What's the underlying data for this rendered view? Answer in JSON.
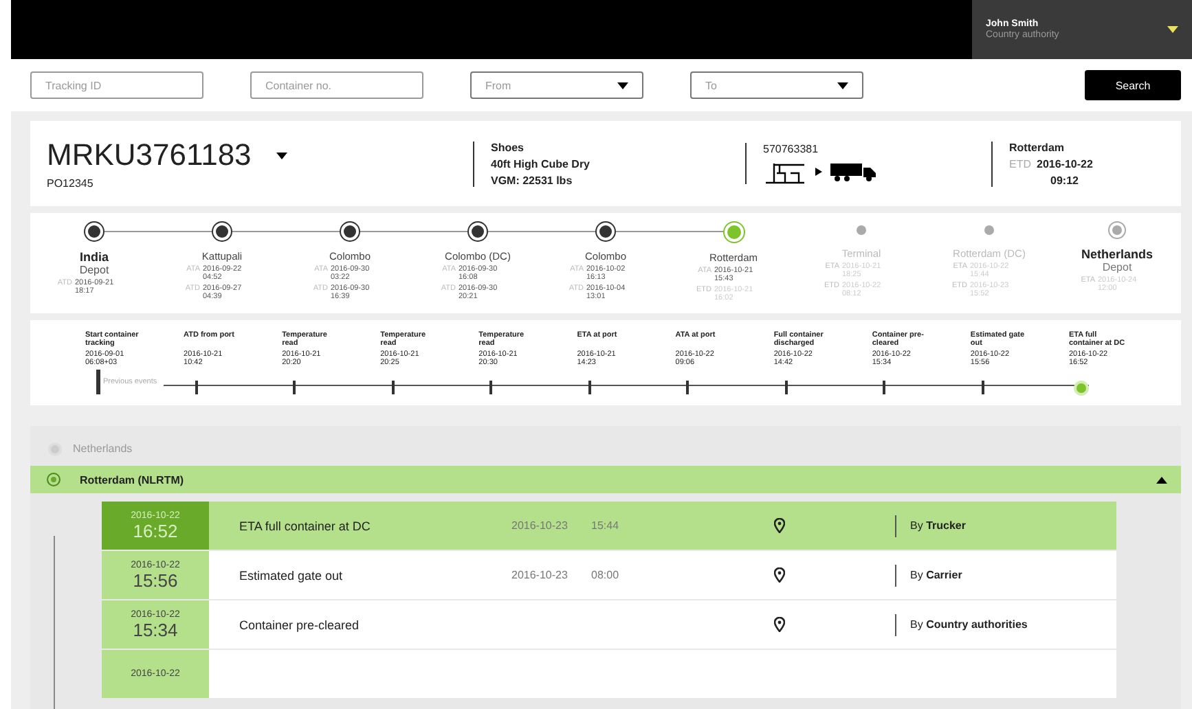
{
  "user": {
    "name": "John Smith",
    "role": "Country authority"
  },
  "search": {
    "fields": [
      {
        "kind": "text",
        "placeholder": "Tracking ID"
      },
      {
        "kind": "text",
        "placeholder": "Container no."
      },
      {
        "kind": "select",
        "placeholder": "From"
      },
      {
        "kind": "select",
        "placeholder": "To"
      }
    ],
    "button": "Search"
  },
  "shipment": {
    "container": "MRKU3761183",
    "po": "PO12345",
    "goods": "Shoes",
    "equipment": "40ft High Cube Dry",
    "vgm": "VGM: 22531 lbs",
    "booking": "570763381",
    "destination": "Rotterdam",
    "eta_label": "ETD",
    "eta_date": "2016-10-22",
    "eta_time": "09:12"
  },
  "stops": [
    {
      "name": "India",
      "sub": "Depot",
      "kind": "done",
      "lines": [
        {
          "label": "ATD",
          "date": "2016-09-21",
          "time": "18:17"
        }
      ]
    },
    {
      "name": "Kattupali",
      "kind": "done",
      "lines": [
        {
          "label": "ATA",
          "date": "2016-09-22",
          "time": "04:52"
        },
        {
          "label": "ATD",
          "date": "2016-09-27",
          "time": "04:39"
        }
      ]
    },
    {
      "name": "Colombo",
      "kind": "done",
      "lines": [
        {
          "label": "ATA",
          "date": "2016-09-30",
          "time": "03:22"
        },
        {
          "label": "ATD",
          "date": "2016-09-30",
          "time": "16:39"
        }
      ]
    },
    {
      "name": "Colombo (DC)",
      "kind": "done",
      "lines": [
        {
          "label": "ATA",
          "date": "2016-09-30",
          "time": "16:08"
        },
        {
          "label": "ATD",
          "date": "2016-09-30",
          "time": "20:21"
        }
      ]
    },
    {
      "name": "Colombo",
      "kind": "done",
      "lines": [
        {
          "label": "ATA",
          "date": "2016-10-02",
          "time": "16:13"
        },
        {
          "label": "ATD",
          "date": "2016-10-04",
          "time": "13:01"
        }
      ]
    },
    {
      "name": "Rotterdam",
      "kind": "current",
      "lines": [
        {
          "label": "ATA",
          "date": "2016-10-21",
          "time": "15:43"
        },
        {
          "label": "ETD",
          "date": "2016-10-21",
          "time": "16:02"
        }
      ]
    },
    {
      "name": "Terminal",
      "kind": "pending",
      "lines": [
        {
          "label": "ETA",
          "date": "2016-10-21",
          "time": "18:25"
        },
        {
          "label": "ETD",
          "date": "2016-10-22",
          "time": "08:12"
        }
      ]
    },
    {
      "name": "Rotterdam (DC)",
      "kind": "pending",
      "lines": [
        {
          "label": "ETA",
          "date": "2016-10-22",
          "time": "15:44"
        },
        {
          "label": "ETD",
          "date": "2016-10-23",
          "time": "15:52"
        }
      ]
    },
    {
      "name": "Netherlands",
      "sub": "Depot",
      "kind": "pending",
      "lines": [
        {
          "label": "ETA",
          "date": "2016-10-24",
          "time": "12:00"
        }
      ]
    }
  ],
  "events": {
    "previous": "Previous events",
    "items": [
      {
        "label": "Start container tracking",
        "date": "2016-09-01",
        "time": "06:08+03",
        "current": false
      },
      {
        "label": "ATD from port",
        "date": "2016-10-21",
        "time": "10:42",
        "current": false
      },
      {
        "label": "Temperature read",
        "date": "2016-10-21",
        "time": "20:20",
        "current": false
      },
      {
        "label": "Temperature read",
        "date": "2016-10-21",
        "time": "20:25",
        "current": false
      },
      {
        "label": "Temperature read",
        "date": "2016-10-21",
        "time": "20:30",
        "current": false
      },
      {
        "label": "ETA at port",
        "date": "2016-10-21",
        "time": "14:23",
        "current": false
      },
      {
        "label": "ATA at port",
        "date": "2016-10-22",
        "time": "09:06",
        "current": false
      },
      {
        "label": "Full container discharged",
        "date": "2016-10-22",
        "time": "14:42",
        "current": false
      },
      {
        "label": "Container pre-cleared",
        "date": "2016-10-22",
        "time": "15:34",
        "current": false
      },
      {
        "label": "Estimated gate out",
        "date": "2016-10-22",
        "time": "15:56",
        "current": false
      },
      {
        "label": "ETA full container at DC",
        "date": "2016-10-22",
        "time": "16:52",
        "current": true
      }
    ]
  },
  "log": {
    "country": "Netherlands",
    "location": "Rotterdam (NLRTM)",
    "expanded": true,
    "rows": [
      {
        "date": "2016-10-22",
        "time": "16:52",
        "title": "ETA full container at DC",
        "date2": "2016-10-23",
        "time2": "15:44",
        "by": "By **Trucker**",
        "selected": true
      },
      {
        "date": "2016-10-22",
        "time": "15:56",
        "title": "Estimated gate out",
        "date2": "2016-10-23",
        "time2": "08:00",
        "by": "By **Carrier**",
        "selected": false
      },
      {
        "date": "2016-10-22",
        "time": "15:34",
        "title": "Container pre-cleared",
        "by": "By **Country authorities**",
        "selected": false
      },
      {
        "date": "2016-10-22",
        "selected": false
      }
    ]
  }
}
